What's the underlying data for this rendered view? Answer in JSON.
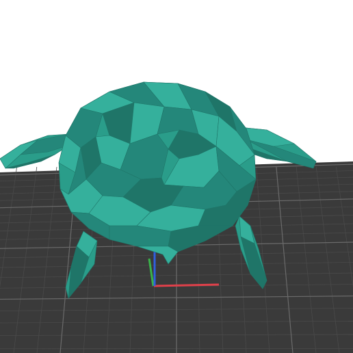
{
  "viewport": {
    "background": "#ffffff",
    "bed_color": "#3a3a3a",
    "grid_minor_color": "#4a4a4a",
    "grid_major_color": "#6b6b6b"
  },
  "model": {
    "name_icon": "sea-turtle-model",
    "color": "#2a9d8a",
    "shade_dark": "#1f7568",
    "shade_mid": "#24877a",
    "shade_light": "#35b09c"
  },
  "axes": {
    "x_color": "#e0404a",
    "y_color": "#3ab34a",
    "z_color": "#3060e0"
  }
}
